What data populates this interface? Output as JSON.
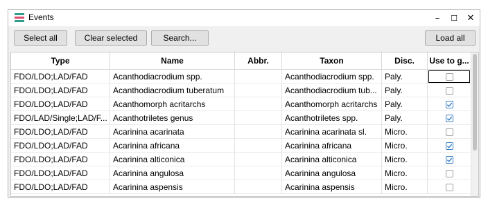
{
  "window": {
    "title": "Events"
  },
  "title_controls": {
    "minimize": "–",
    "maximize": "☐",
    "close": "✕"
  },
  "toolbar": {
    "select_all": "Select all",
    "clear_selected": "Clear selected",
    "search": "Search...",
    "load_all": "Load all"
  },
  "table": {
    "columns": [
      "Type",
      "Name",
      "Abbr.",
      "Taxon",
      "Disc.",
      "Use to g..."
    ],
    "rows": [
      {
        "type": "FDO/LDO;LAD/FAD",
        "name": "Acanthodiacrodium spp.",
        "abbr": "",
        "taxon": "Acanthodiacrodium spp.",
        "disc": "Paly.",
        "checked": false,
        "focused": true
      },
      {
        "type": "FDO/LDO;LAD/FAD",
        "name": "Acanthodiacrodium tuberatum",
        "abbr": "",
        "taxon": "Acanthodiacrodium tub...",
        "disc": "Paly.",
        "checked": false,
        "focused": false
      },
      {
        "type": "FDO/LDO;LAD/FAD",
        "name": "Acanthomorph acritarchs",
        "abbr": "",
        "taxon": "Acanthomorph acritarchs",
        "disc": "Paly.",
        "checked": true,
        "focused": false
      },
      {
        "type": "FDO/LAD/Single;LAD/F...",
        "name": "Acanthotriletes genus",
        "abbr": "",
        "taxon": "Acanthotriletes spp.",
        "disc": "Paly.",
        "checked": true,
        "focused": false
      },
      {
        "type": "FDO/LDO;LAD/FAD",
        "name": "Acarinina acarinata",
        "abbr": "",
        "taxon": "Acarinina acarinata sl.",
        "disc": "Micro.",
        "checked": false,
        "focused": false
      },
      {
        "type": "FDO/LDO;LAD/FAD",
        "name": "Acarinina africana",
        "abbr": "",
        "taxon": "Acarinina africana",
        "disc": "Micro.",
        "checked": true,
        "focused": false
      },
      {
        "type": "FDO/LDO;LAD/FAD",
        "name": "Acarinina alticonica",
        "abbr": "",
        "taxon": "Acarinina alticonica",
        "disc": "Micro.",
        "checked": true,
        "focused": false
      },
      {
        "type": "FDO/LDO;LAD/FAD",
        "name": "Acarinina angulosa",
        "abbr": "",
        "taxon": "Acarinina angulosa",
        "disc": "Micro.",
        "checked": false,
        "focused": false
      },
      {
        "type": "FDO/LDO;LAD/FAD",
        "name": "Acarinina aspensis",
        "abbr": "",
        "taxon": "Acarinina aspensis",
        "disc": "Micro.",
        "checked": false,
        "focused": false
      }
    ]
  },
  "colors": {
    "check_accent": "#3c80c6",
    "app_icon": [
      "#2e9e8f",
      "#d94a6a",
      "#2e9e8f"
    ]
  },
  "icons": {
    "app": "events-app-icon",
    "checkmark": "checkmark-icon"
  }
}
